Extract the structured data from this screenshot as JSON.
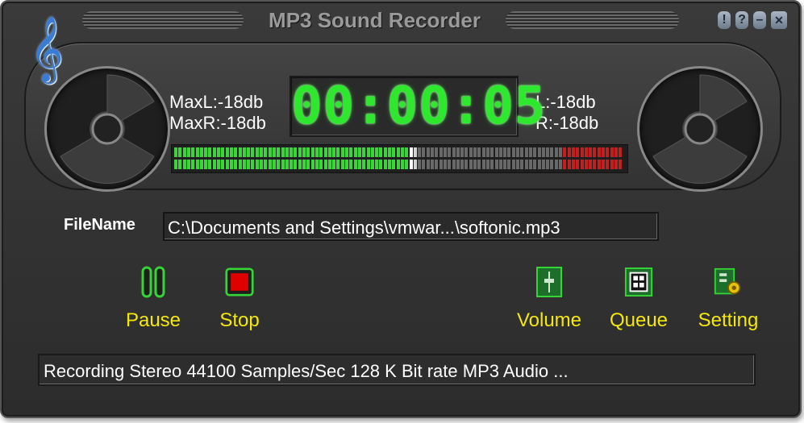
{
  "window": {
    "title": "MP3 Sound Recorder"
  },
  "title_buttons": [
    {
      "name": "info",
      "glyph": "!"
    },
    {
      "name": "help",
      "glyph": "?"
    },
    {
      "name": "minimize",
      "glyph": "–"
    },
    {
      "name": "close",
      "glyph": "✕"
    }
  ],
  "logo": {
    "glyph": "𝄞",
    "color": "#3a7bd8"
  },
  "levels": {
    "max_left": "MaxL:-18db",
    "max_right": "MaxR:-18db",
    "left": "L:-18db",
    "right": "R:-18db"
  },
  "timer": "00:00:05",
  "meter": {
    "level": 0.53,
    "warn_start": 0.86,
    "colors": {
      "active": "#3bd43b",
      "idle": "#7a7a7a",
      "warn": "#c02020",
      "peak": "#ffffff"
    }
  },
  "file": {
    "label": "FileName",
    "path": "C:\\Documents and Settings\\vmwar...\\softonic.mp3"
  },
  "controls": [
    {
      "key": "pause",
      "label": "Pause",
      "icon": "pause-icon"
    },
    {
      "key": "stop",
      "label": "Stop",
      "icon": "stop-icon"
    },
    {
      "key": "volume",
      "label": "Volume",
      "icon": "volume-icon"
    },
    {
      "key": "queue",
      "label": "Queue",
      "icon": "queue-icon"
    },
    {
      "key": "setting",
      "label": "Setting",
      "icon": "setting-icon"
    }
  ],
  "status": "Recording Stereo 44100 Samples/Sec 128 K Bit rate MP3 Audio ...",
  "colors": {
    "accent_green": "#2ee82e",
    "label_yellow": "#f4e80a",
    "stop_red": "#e00000"
  }
}
